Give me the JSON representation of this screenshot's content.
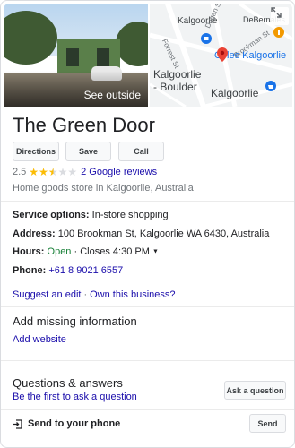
{
  "media": {
    "photo_label": "See outside",
    "map": {
      "labels": {
        "kalgoorlie_top": "Kalgoorlie",
        "debernales": "DeBernales",
        "forrest_st": "Forrest St",
        "dugan_st": "Dugan St",
        "brookman_st": "Brookman St",
        "coles": "Coles Kalgoorlie",
        "area_line1": "Kalgoorlie",
        "area_line2": "- Boulder",
        "kalgoorlie_bottom": "Kalgoorlie"
      }
    }
  },
  "business": {
    "name": "The Green Door",
    "actions": {
      "directions": "Directions",
      "save": "Save",
      "call": "Call"
    },
    "rating": {
      "score": "2.5",
      "stars_value": 2.5,
      "stars_max": 5,
      "reviews_link": "2 Google reviews"
    },
    "category": "Home goods store in Kalgoorlie, Australia"
  },
  "details": {
    "service_label": "Service options:",
    "service_value": "In-store shopping",
    "address_label": "Address:",
    "address_value": "100 Brookman St, Kalgoorlie WA 6430, Australia",
    "hours_label": "Hours:",
    "hours_status": "Open",
    "hours_detail": "· Closes 4:30 PM",
    "phone_label": "Phone:",
    "phone_value": "+61 8 9021 6557"
  },
  "links": {
    "suggest_edit": "Suggest an edit",
    "separator": "·",
    "own_business": "Own this business?"
  },
  "missing_info": {
    "title": "Add missing information",
    "add_website": "Add website"
  },
  "qa": {
    "title": "Questions & answers",
    "first_to_ask": "Be the first to ask a question",
    "ask_button": "Ask a question"
  },
  "send": {
    "label": "Send to your phone",
    "button": "Send"
  },
  "colors": {
    "link": "#1a0dab",
    "open": "#188038",
    "star": "#fbbc04",
    "pin": "#ea4335"
  }
}
